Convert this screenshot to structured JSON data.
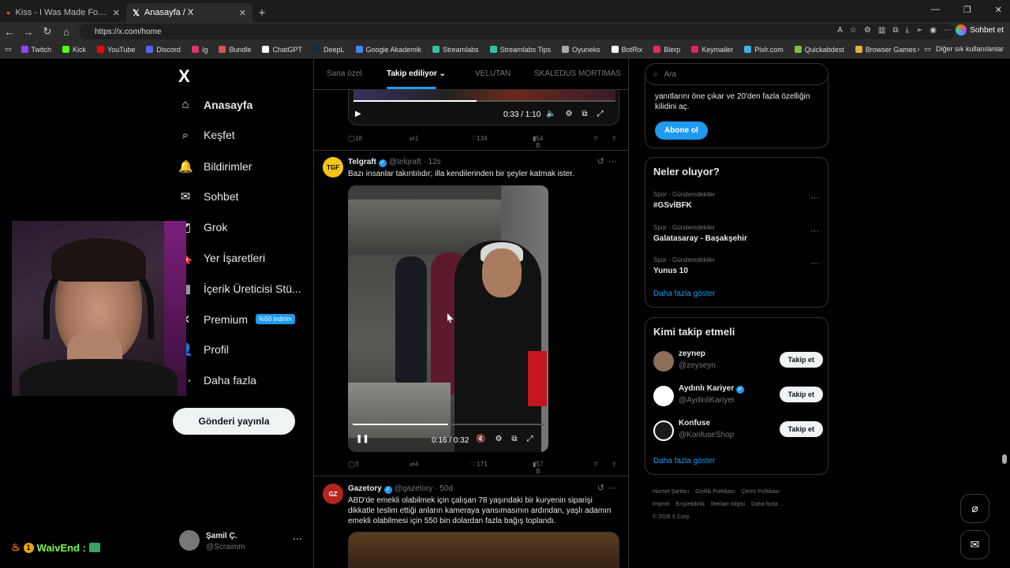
{
  "browser": {
    "tabs": [
      {
        "title": "Kiss - I Was Made For Lovin' You",
        "active": false
      },
      {
        "title": "Anasayfa / X",
        "active": true
      }
    ],
    "url": "https://x.com/home",
    "sohbet_label": "Sohbet et",
    "bookmarks": [
      {
        "label": "Twitch",
        "color": "#9146ff"
      },
      {
        "label": "Kick",
        "color": "#53fc18"
      },
      {
        "label": "YouTube",
        "color": "#ff0000"
      },
      {
        "label": "Discord",
        "color": "#5865f2"
      },
      {
        "label": "Ig",
        "color": "#e1306c"
      },
      {
        "label": "Bundle",
        "color": "#d9534f"
      },
      {
        "label": "ChatGPT",
        "color": "#ffffff"
      },
      {
        "label": "DeepL",
        "color": "#0f2b46"
      },
      {
        "label": "Google Akademik",
        "color": "#4285f4"
      },
      {
        "label": "Streamlabs",
        "color": "#31c3a2"
      },
      {
        "label": "Streamlabs Tips",
        "color": "#31c3a2"
      },
      {
        "label": "Oyuneks",
        "color": "#aaaaaa"
      },
      {
        "label": "BotRix",
        "color": "#ffffff"
      },
      {
        "label": "Blerp",
        "color": "#e02e5c"
      },
      {
        "label": "Keymailer",
        "color": "#e0245e"
      },
      {
        "label": "Pixlr.com",
        "color": "#3fb1e5"
      },
      {
        "label": "Quickabdest",
        "color": "#7fbf3f"
      },
      {
        "label": "Browser Games",
        "color": "#e0b040"
      }
    ],
    "other_bookmarks": "Diğer sık kullanılanlar"
  },
  "sidebar": {
    "logo": "X",
    "items": [
      {
        "label": "Anasayfa",
        "icon": "home-icon",
        "glyph": "⌂"
      },
      {
        "label": "Keşfet",
        "icon": "search-icon",
        "glyph": "⌕"
      },
      {
        "label": "Bildirimler",
        "icon": "bell-icon",
        "glyph": "🔔"
      },
      {
        "label": "Sohbet",
        "icon": "mail-icon",
        "glyph": "✉"
      },
      {
        "label": "Grok",
        "icon": "grok-icon",
        "glyph": "◩"
      },
      {
        "label": "Yer İşaretleri",
        "icon": "bookmark-icon",
        "glyph": "🔖"
      },
      {
        "label": "İçerik Üreticisi Stü...",
        "icon": "creator-studio-icon",
        "glyph": "▦"
      },
      {
        "label": "Premium",
        "icon": "premium-icon",
        "glyph": "✕"
      },
      {
        "label": "Profil",
        "icon": "profile-icon",
        "glyph": "👤"
      },
      {
        "label": "Daha fazla",
        "icon": "more-circle-icon",
        "glyph": "⋯"
      }
    ],
    "premium_badge": "%50 indirim",
    "post_button": "Gönderi yayınla",
    "account": {
      "name": "Şamil Ç.",
      "handle": "@Scraimm"
    }
  },
  "overlay": {
    "waiv_text": "WaivEnd :",
    "badge_number": "1"
  },
  "feed": {
    "tabs": [
      "Sana özel",
      "Takip ediliyor",
      "VELUTAN",
      "SKALEDUS MORTIMAS"
    ],
    "active_tab": "Takip ediliyor",
    "prev_video": {
      "time": "0:33 / 1:10",
      "progress": 0.47
    },
    "prev_actions": {
      "replies": "18",
      "reposts": "1",
      "likes": "134",
      "views": "54 B"
    },
    "tweets": [
      {
        "name": "Telgraft",
        "handle": "@telqraft",
        "time": "12s",
        "avatar_text": "TGF",
        "avatar_color": "#f5c518",
        "text": "Bazı insanlar takıntılıdır; illa kendilerinden bir şeyler katmak ister.",
        "video_time": "0:16 / 0:32",
        "video_progress": 0.5,
        "replies": "3",
        "reposts": "4",
        "likes": "171",
        "views": "57 B"
      },
      {
        "name": "Gazetory",
        "handle": "@gazetory",
        "time": "50d",
        "avatar_text": "GZ",
        "avatar_color": "#b3261e",
        "text": "ABD'de emekli olabilmek için çalışan 78 yaşındaki bir kuryenin siparişi dikkatle teslim ettiği anların kameraya yansımasının ardından, yaşlı adamın emekli olabilmesi için 550 bin dolardan fazla bağış toplandı."
      }
    ]
  },
  "right": {
    "search_placeholder": "Ara",
    "premium_text": "yanıtlarını öne çıkar ve 20'den fazla özelliğin kilidini aç.",
    "subscribe_button": "Abone ol",
    "trends_title": "Neler oluyor?",
    "trends": [
      {
        "category": "Spor · Gündemdekiler",
        "title": "#GSvİBFK"
      },
      {
        "category": "Spor · Gündemdekiler",
        "title": "Galatasaray - Başakşehir"
      },
      {
        "category": "Spor · Gündemdekiler",
        "title": "Yunus 10"
      }
    ],
    "show_more": "Daha fazla göster",
    "follow_title": "Kimi takip etmeli",
    "follow": [
      {
        "name": "zeynep",
        "handle": "@zeyseyn",
        "verified": false,
        "avatar_color": "#8b6f5a"
      },
      {
        "name": "Aydınlı Kariyer",
        "handle": "@AydinliKariyer",
        "verified": true,
        "avatar_color": "#ffffff"
      },
      {
        "name": "Konfuse",
        "handle": "@KonfuseShop",
        "verified": false,
        "avatar_color": "#1a1a1a"
      }
    ],
    "follow_button": "Takip et",
    "footer": [
      "Hizmet Şartları",
      "Gizlilik Politikası",
      "Çerez Politikası",
      "Imprint",
      "Erişilebilirlik",
      "Reklam bilgisi",
      "Daha fazla ...",
      "© 2026 X Corp."
    ]
  }
}
